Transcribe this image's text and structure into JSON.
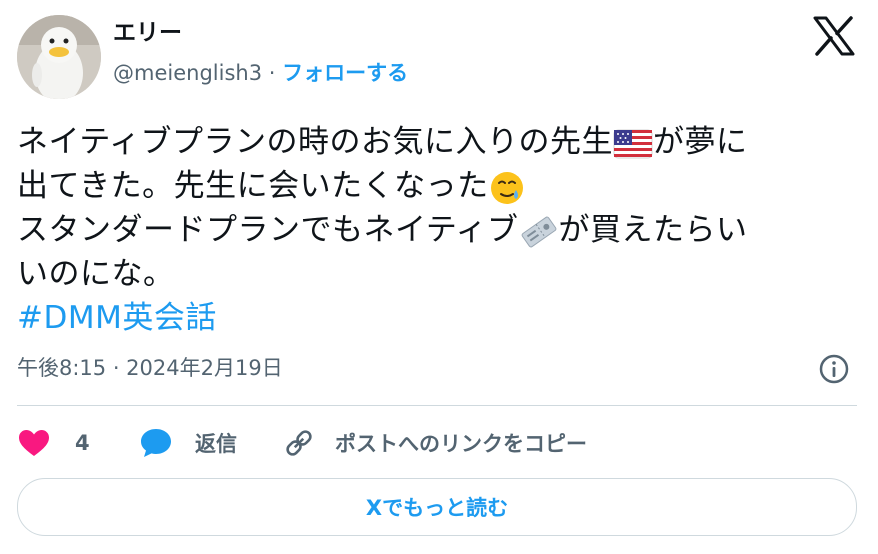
{
  "author": {
    "display_name": "エリー",
    "handle": "@meienglish3",
    "separator": " · ",
    "follow_label": "フォローする"
  },
  "tweet": {
    "line1a": "ネイティブプランの時のお気に入りの先生",
    "line1b": "が夢に",
    "line2": "出てきた。先生に会いたくなった",
    "line3a": "スタンダードプランでもネイティブ",
    "line3b": "が買えたらい",
    "line4": "いのにな。",
    "hashtag": "#DMM英会話",
    "emoji_names": [
      "us-flag-emoji",
      "face-holding-back-tears-emoji",
      "ticket-emoji"
    ]
  },
  "timestamp": "午後8:15 · 2024年2月19日",
  "actions": {
    "like_count": "4",
    "reply_label": "返信",
    "copy_link_label": "ポストへのリンクをコピー"
  },
  "read_more_label": "Xでもっと読む",
  "colors": {
    "accent": "#1d9bf0",
    "like": "#f91880",
    "secondary_text": "#536471",
    "border": "#cfd9de"
  }
}
